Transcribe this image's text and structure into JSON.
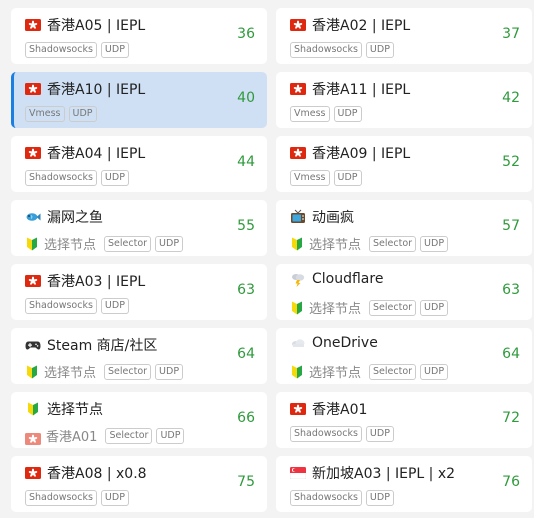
{
  "colors": {
    "latency": "#2f9a3c",
    "selected_bg": "#cfe0f4",
    "selected_bar": "#1a7fe0"
  },
  "nodes": [
    {
      "name": "香港A05 | IEPL",
      "icon": "hk-flag-icon",
      "tags": [
        "Shadowsocks",
        "UDP"
      ],
      "latency": "36"
    },
    {
      "name": "香港A02 | IEPL",
      "icon": "hk-flag-icon",
      "tags": [
        "Shadowsocks",
        "UDP"
      ],
      "latency": "37"
    },
    {
      "name": "香港A10 | IEPL",
      "icon": "hk-flag-icon",
      "tags": [
        "Vmess",
        "UDP"
      ],
      "latency": "40",
      "selected": true
    },
    {
      "name": "香港A11 | IEPL",
      "icon": "hk-flag-icon",
      "tags": [
        "Vmess",
        "UDP"
      ],
      "latency": "42"
    },
    {
      "name": "香港A04 | IEPL",
      "icon": "hk-flag-icon",
      "tags": [
        "Shadowsocks",
        "UDP"
      ],
      "latency": "44"
    },
    {
      "name": "香港A09 | IEPL",
      "icon": "hk-flag-icon",
      "tags": [
        "Vmess",
        "UDP"
      ],
      "latency": "52"
    },
    {
      "name": "漏网之鱼",
      "icon": "fish-icon",
      "sub_icon": "beginner-icon",
      "sub_text": "选择节点",
      "tags": [
        "Selector",
        "UDP"
      ],
      "latency": "55"
    },
    {
      "name": "动画疯",
      "icon": "tv-icon",
      "sub_icon": "beginner-icon",
      "sub_text": "选择节点",
      "tags": [
        "Selector",
        "UDP"
      ],
      "latency": "57"
    },
    {
      "name": "香港A03 | IEPL",
      "icon": "hk-flag-icon",
      "tags": [
        "Shadowsocks",
        "UDP"
      ],
      "latency": "63"
    },
    {
      "name": "Cloudflare",
      "icon": "storm-cloud-icon",
      "sub_icon": "beginner-icon",
      "sub_text": "选择节点",
      "tags": [
        "Selector",
        "UDP"
      ],
      "latency": "63"
    },
    {
      "name": "Steam 商店/社区",
      "icon": "gamepad-icon",
      "sub_icon": "beginner-icon",
      "sub_text": "选择节点",
      "tags": [
        "Selector",
        "UDP"
      ],
      "latency": "64"
    },
    {
      "name": "OneDrive",
      "icon": "cloud-icon",
      "sub_icon": "beginner-icon",
      "sub_text": "选择节点",
      "tags": [
        "Selector",
        "UDP"
      ],
      "latency": "64"
    },
    {
      "name": "选择节点",
      "icon": "beginner-icon",
      "sub_icon": "hk-flag-icon",
      "sub_text": "香港A01",
      "tags": [
        "Selector",
        "UDP"
      ],
      "latency": "66"
    },
    {
      "name": "香港A01",
      "icon": "hk-flag-icon",
      "tags": [
        "Shadowsocks",
        "UDP"
      ],
      "latency": "72"
    },
    {
      "name": "香港A08 | x0.8",
      "icon": "hk-flag-icon",
      "tags": [
        "Shadowsocks",
        "UDP"
      ],
      "latency": "75"
    },
    {
      "name": "新加坡A03 | IEPL | x2",
      "icon": "sg-flag-icon",
      "tags": [
        "Shadowsocks",
        "UDP"
      ],
      "latency": "76"
    }
  ]
}
